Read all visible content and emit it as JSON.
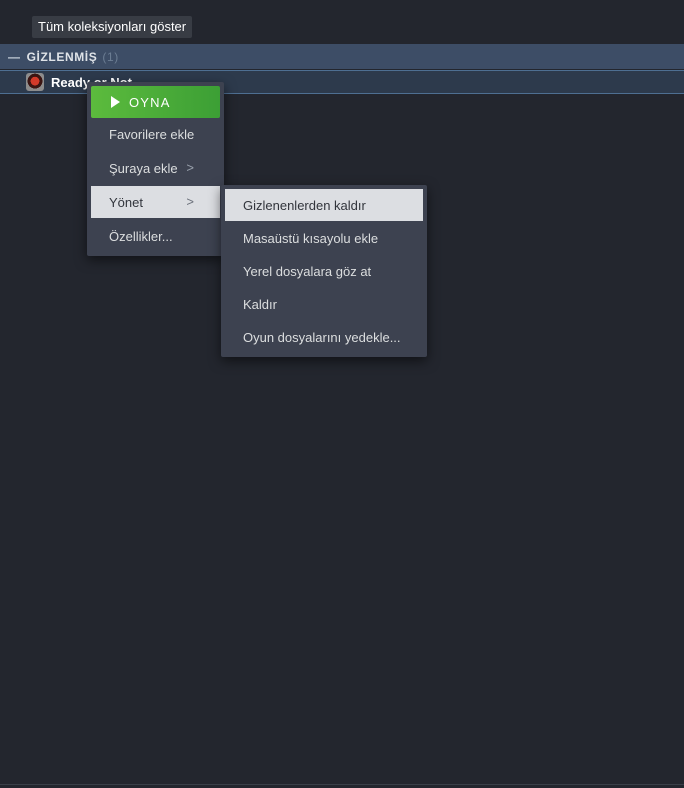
{
  "header": {
    "show_all_collections": "Tüm koleksiyonları göster"
  },
  "section": {
    "title": "GİZLENMİŞ",
    "count": "(1)"
  },
  "game": {
    "name": "Ready or Not"
  },
  "context_menu": {
    "play_label": "OYNA",
    "items": [
      {
        "label": "Favorilere ekle"
      },
      {
        "label": "Şuraya ekle",
        "has_submenu": true
      },
      {
        "label": "Yönet",
        "has_submenu": true,
        "highlighted": true
      },
      {
        "label": "Özellikler..."
      }
    ]
  },
  "submenu": {
    "items": [
      {
        "label": "Gizlenenlerden kaldır",
        "highlighted": true
      },
      {
        "label": "Masaüstü kısayolu ekle"
      },
      {
        "label": "Yerel dosyalara göz at"
      },
      {
        "label": "Kaldır"
      },
      {
        "label": "Oyun dosyalarını yedekle..."
      }
    ]
  },
  "colors": {
    "play_green": "#5cbb3d",
    "section_blue": "#3d4d66",
    "menu_bg": "#3d4250",
    "highlight": "#dcdee2"
  }
}
